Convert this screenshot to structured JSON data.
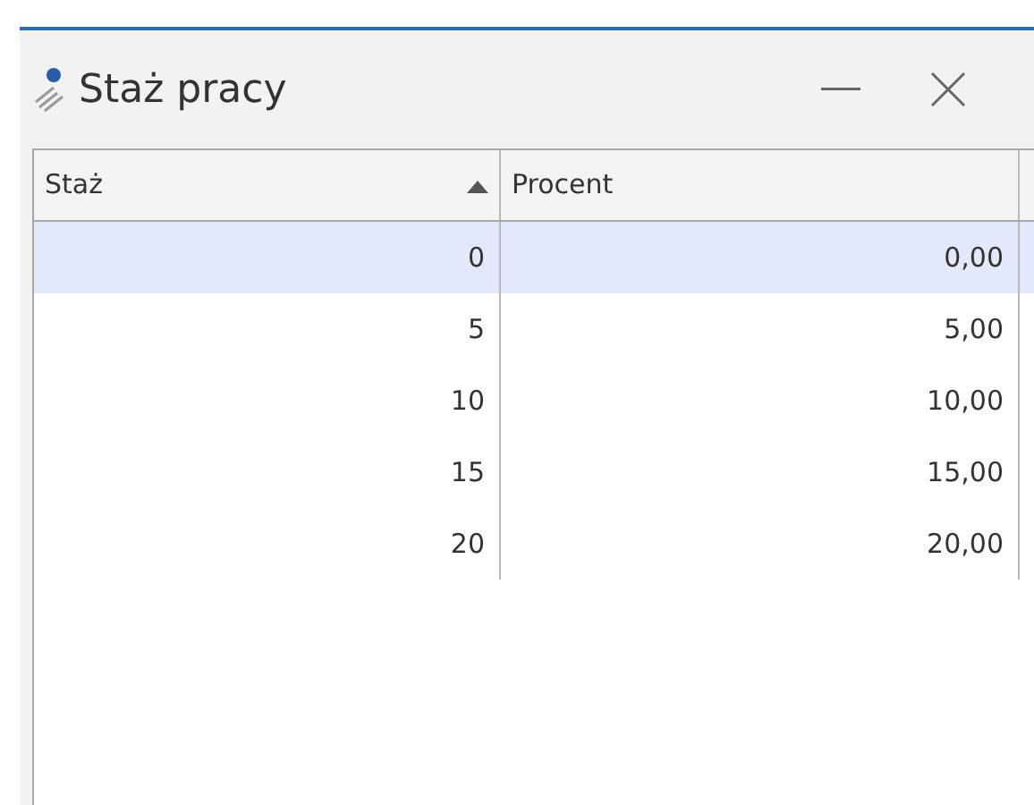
{
  "window": {
    "title": "Staż pracy"
  },
  "table": {
    "columns": [
      {
        "label": "Staż",
        "sorted": true
      },
      {
        "label": "Procent",
        "sorted": false
      }
    ],
    "rows": [
      {
        "cells": [
          "0",
          "0,00"
        ],
        "selected": true
      },
      {
        "cells": [
          "5",
          "5,00"
        ],
        "selected": false
      },
      {
        "cells": [
          "10",
          "10,00"
        ],
        "selected": false
      },
      {
        "cells": [
          "15",
          "15,00"
        ],
        "selected": false
      },
      {
        "cells": [
          "20",
          "20,00"
        ],
        "selected": false
      }
    ]
  }
}
